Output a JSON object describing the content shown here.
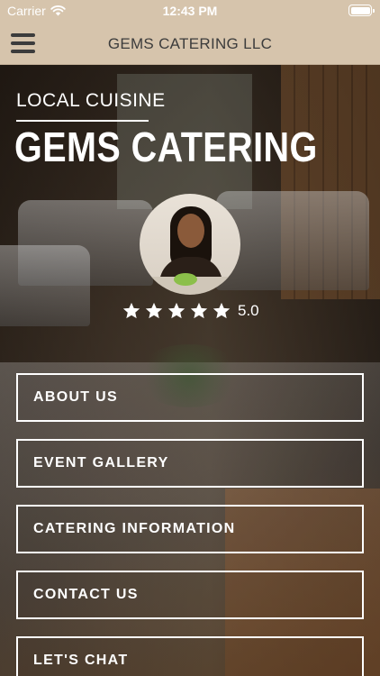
{
  "status_bar": {
    "carrier": "Carrier",
    "time": "12:43 PM"
  },
  "nav": {
    "title": "GEMS CATERING LLC",
    "menu_icon": "hamburger-menu-icon"
  },
  "hero": {
    "eyebrow": "LOCAL CUISINE",
    "headline": "GEMS CATERING",
    "rating": {
      "stars": 5,
      "value": "5.0"
    }
  },
  "menu": {
    "items": [
      {
        "label": "ABOUT US"
      },
      {
        "label": "EVENT GALLERY"
      },
      {
        "label": "CATERING INFORMATION"
      },
      {
        "label": "CONTACT US"
      },
      {
        "label": "LET'S CHAT"
      }
    ]
  },
  "colors": {
    "nav_background": "#d6c4ac",
    "nav_text": "#3c3c3c",
    "overlay_text": "#ffffff"
  }
}
